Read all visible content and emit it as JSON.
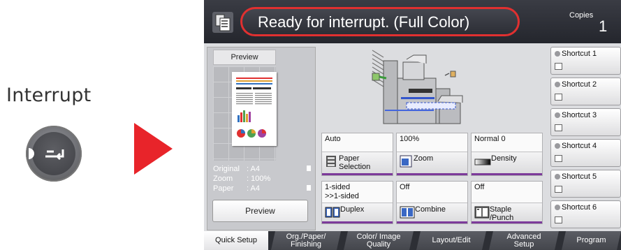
{
  "interrupt": {
    "label": "Interrupt"
  },
  "status": {
    "message": "Ready for interrupt. (Full Color)"
  },
  "copies": {
    "label": "Copies",
    "value": "1"
  },
  "preview": {
    "title": "Preview",
    "info": [
      {
        "key": "Original",
        "value": ": A4"
      },
      {
        "key": "Zoom",
        "value": ": 100%"
      },
      {
        "key": "Paper",
        "value": ": A4"
      }
    ],
    "button_label": "Preview"
  },
  "functions": {
    "paper": {
      "value": "Auto",
      "label": "Paper Selection"
    },
    "zoom": {
      "value": "100%",
      "label": "Zoom"
    },
    "density": {
      "value": "Normal 0",
      "label": "Density"
    },
    "duplex": {
      "value": "1-sided >>1-sided",
      "label": "Duplex"
    },
    "combine": {
      "value": "Off",
      "label": "Combine"
    },
    "staple": {
      "value": "Off",
      "label": "Staple /Punch"
    }
  },
  "shortcuts": [
    "Shortcut 1",
    "Shortcut 2",
    "Shortcut 3",
    "Shortcut 4",
    "Shortcut 5",
    "Shortcut 6"
  ],
  "tabs": [
    {
      "label": "Quick Setup"
    },
    {
      "label": "Org./Paper/ Finishing"
    },
    {
      "label": "Color/ Image Quality"
    },
    {
      "label": "Layout/Edit"
    },
    {
      "label": "Advanced Setup"
    },
    {
      "label": "Program"
    }
  ],
  "colors": {
    "accent_purple": "#7c3a9a",
    "highlight_red": "#e03030",
    "arrow_red": "#e8242a",
    "topbar": "#2c2e35"
  },
  "icons": {
    "interrupt_key": "interrupt-arrow-icon",
    "document": "document-stack-icon",
    "paper": "paper-tray-icon",
    "zoom": "zoom-icon",
    "density": "density-bar-icon",
    "duplex": "duplex-icon",
    "combine": "combine-icon",
    "staple": "staple-icon",
    "shortcut": "hand-pointer-icon"
  }
}
